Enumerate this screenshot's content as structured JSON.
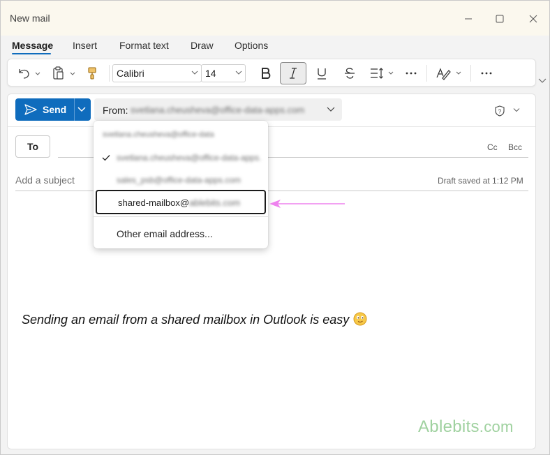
{
  "window": {
    "title": "New mail"
  },
  "tabs": [
    {
      "label": "Message",
      "active": true
    },
    {
      "label": "Insert"
    },
    {
      "label": "Format text"
    },
    {
      "label": "Draw"
    },
    {
      "label": "Options"
    }
  ],
  "toolbar": {
    "font": "Calibri",
    "font_size": "14"
  },
  "compose": {
    "send_label": "Send",
    "from_label": "From:",
    "from_value": "svetlana.cheusheva@office-data-apps.com",
    "to_label": "To",
    "cc_label": "Cc",
    "bcc_label": "Bcc",
    "subject_placeholder": "Add a subject",
    "draft_status": "Draft saved at 1:12 PM",
    "body_text": "Sending an email from a shared mailbox in Outlook is easy"
  },
  "from_dropdown": {
    "header": "svetlana.cheusheva@office-data",
    "items": [
      {
        "label": "svetlana.cheusheva@office-data-apps.com",
        "checked": true
      },
      {
        "label": "sales_psb@office-data-apps.com"
      },
      {
        "label_visible": "shared-mailbox@",
        "label_blurred": "ablebits.com",
        "selected": true
      }
    ],
    "other_label": "Other email address..."
  },
  "watermark": {
    "brand": "Ablebits",
    "suffix": ".com"
  },
  "colors": {
    "accent": "#0f6cbd",
    "arrow": "#ee82ee",
    "watermark": "#9fd19f"
  }
}
